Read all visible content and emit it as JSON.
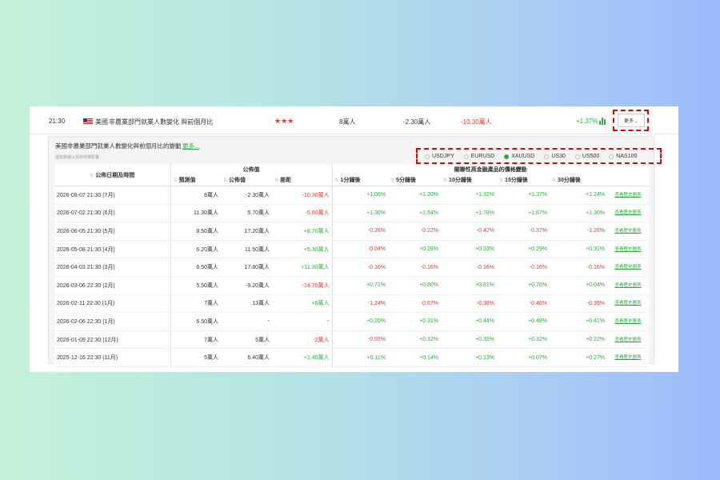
{
  "event_row": {
    "time": "21:30",
    "country": "美國",
    "title": "非農業部門就業人數變化 與前個月比",
    "stars": "★★★",
    "forecast": "8萬人",
    "actual": "-2.30萬人",
    "deviation": "-10.30萬人",
    "change": "+1.37%",
    "more_button": "更多→"
  },
  "panel": {
    "title": "美國非農業部門就業人數變化與前個月比的變動",
    "more_link": "更多...",
    "note": "過去數據以及對市場影響",
    "instruments": [
      {
        "label": "USDJPY",
        "selected": false
      },
      {
        "label": "EURUSD",
        "selected": false
      },
      {
        "label": "XAUUSD",
        "selected": true
      },
      {
        "label": "US30",
        "selected": false
      },
      {
        "label": "US500",
        "selected": false
      },
      {
        "label": "NAS100",
        "selected": false
      }
    ]
  },
  "table": {
    "header_date": "公佈日期及時間",
    "header_published": "公佈值",
    "header_related": "關聯性高金融產品的價格變動",
    "columns": [
      "預測值",
      "公佈值",
      "差距",
      "1分鐘後",
      "5分鐘後",
      "10分鐘後",
      "15分鐘後",
      "30分鐘後"
    ],
    "history_label": "查看歷史圖表",
    "rows": [
      {
        "date": "2026-08-07 21:30 (7月)",
        "forecast": "8萬人",
        "actual": "-2.30萬人",
        "diff": "-10.30萬人",
        "m1": "+1.06%",
        "m5": "+1.20%",
        "m10": "+1.32%",
        "m15": "+1.37%",
        "m30": "+1.24%"
      },
      {
        "date": "2026-07-02 21:30 (6月)",
        "forecast": "11.30萬人",
        "actual": "5.70萬人",
        "diff": "-5.60萬人",
        "m1": "+1.36%",
        "m5": "+1.54%",
        "m10": "+1.78%",
        "m15": "+1.67%",
        "m30": "+1.30%"
      },
      {
        "date": "2026-06-05 21:30 (5月)",
        "forecast": "8.50萬人",
        "actual": "17.20萬人",
        "diff": "+8.70萬人",
        "m1": "-0.26%",
        "m5": "-0.22%",
        "m10": "-0.42%",
        "m15": "-0.37%",
        "m30": "-1.26%"
      },
      {
        "date": "2026-05-08 21:30 (4月)",
        "forecast": "6.20萬人",
        "actual": "11.50萬人",
        "diff": "+5.30萬人",
        "m1": "-0.04%",
        "m5": "+0.28%",
        "m10": "+0.33%",
        "m15": "+0.29%",
        "m30": "+0.31%"
      },
      {
        "date": "2026-04-03 21:30 (3月)",
        "forecast": "6.50萬人",
        "actual": "17.80萬人",
        "diff": "+11.30萬人",
        "m1": "-0.16%",
        "m5": "-0.16%",
        "m10": "-0.16%",
        "m15": "-0.16%",
        "m30": "-0.16%"
      },
      {
        "date": "2026-03-06 22:30 (2月)",
        "forecast": "5.50萬人",
        "actual": "-9.20萬人",
        "diff": "-14.70萬人",
        "m1": "+0.71%",
        "m5": "+0.80%",
        "m10": "+0.81%",
        "m15": "+0.76%",
        "m30": "+0.04%"
      },
      {
        "date": "2026-02-11 22:30 (1月)",
        "forecast": "7萬人",
        "actual": "13萬人",
        "diff": "+6萬人",
        "m1": "-1.24%",
        "m5": "-0.67%",
        "m10": "-0.38%",
        "m15": "-0.46%",
        "m30": "-0.35%"
      },
      {
        "date": "2026-02-06 22:30 (1月)",
        "forecast": "6.50萬人",
        "actual": "-",
        "diff": "-",
        "m1": "+0.20%",
        "m5": "+0.31%",
        "m10": "+0.44%",
        "m15": "+0.48%",
        "m30": "+0.41%"
      },
      {
        "date": "2026-01-09 22:30 (12月)",
        "forecast": "7萬人",
        "actual": "5萬人",
        "diff": "-2萬人",
        "m1": "-0.05%",
        "m5": "+0.32%",
        "m10": "+0.35%",
        "m15": "+0.32%",
        "m30": "+0.22%"
      },
      {
        "date": "2025-12-16 22:30 (11月)",
        "forecast": "5萬人",
        "actual": "6.40萬人",
        "diff": "+1.40萬人",
        "m1": "+0.11%",
        "m5": "+0.14%",
        "m10": "+0.13%",
        "m15": "+0.07%",
        "m30": "+0.27%"
      }
    ]
  },
  "colors": {
    "positive": "#2bad3d",
    "negative": "#e53935",
    "highlight_border": "#ee0000"
  }
}
